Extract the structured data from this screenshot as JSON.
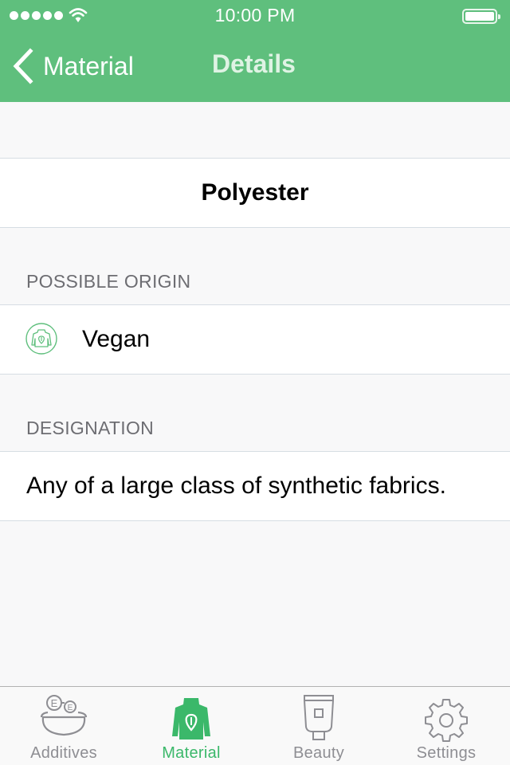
{
  "status_bar": {
    "time": "10:00 PM",
    "signal_bars": 5,
    "wifi": "wifi-icon",
    "battery": "battery-full-icon"
  },
  "nav": {
    "back_label": "Material",
    "title": "Details"
  },
  "material": {
    "name": "Polyester"
  },
  "sections": {
    "origin": {
      "header": "POSSIBLE ORIGIN",
      "value": "Vegan",
      "icon": "vegan-jacket-icon"
    },
    "designation": {
      "header": "DESIGNATION",
      "value": "Any of a large class of synthetic fabrics."
    }
  },
  "tabs": [
    {
      "label": "Additives",
      "icon": "additives-bowl-icon",
      "active": false
    },
    {
      "label": "Material",
      "icon": "material-jacket-icon",
      "active": true
    },
    {
      "label": "Beauty",
      "icon": "beauty-tube-icon",
      "active": false
    },
    {
      "label": "Settings",
      "icon": "gear-icon",
      "active": false
    }
  ],
  "colors": {
    "brand_green": "#5fbf7d",
    "active_tab": "#3bb86a",
    "inactive_tab": "#8e8e93",
    "section_header": "#6d6d72",
    "background": "#f8f8f9"
  }
}
